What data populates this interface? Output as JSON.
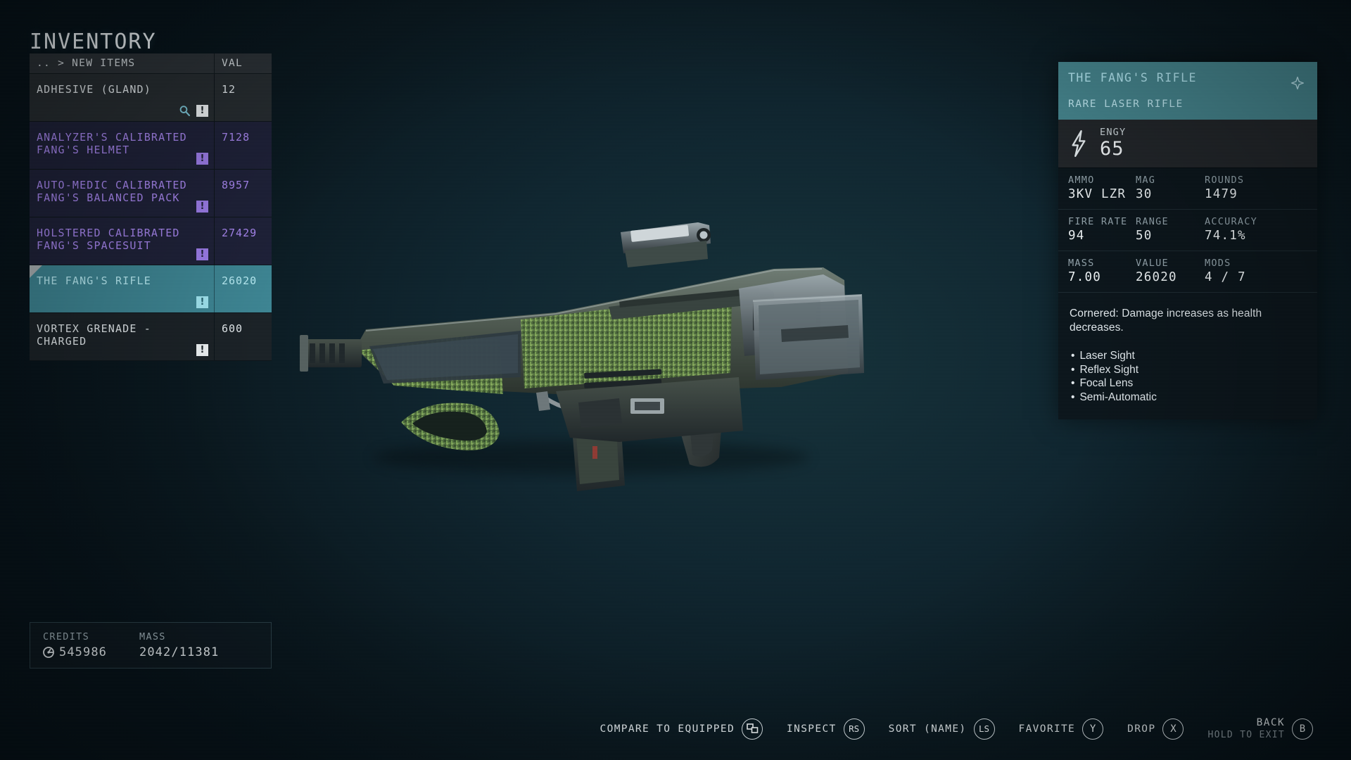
{
  "page_title": "INVENTORY",
  "list": {
    "header": {
      "name": ".. > NEW ITEMS",
      "value": "VAL"
    },
    "rows": [
      {
        "name": "ADHESIVE (GLAND)",
        "value": "12",
        "rarity": "common",
        "badges": [
          "magnifier-icon",
          "new-badge"
        ]
      },
      {
        "name": "ANALYZER'S CALIBRATED\nFANG'S HELMET",
        "value": "7128",
        "rarity": "epic",
        "badges": [
          "new-badge"
        ]
      },
      {
        "name": "AUTO-MEDIC CALIBRATED\nFANG'S BALANCED PACK",
        "value": "8957",
        "rarity": "epic",
        "badges": [
          "new-badge"
        ]
      },
      {
        "name": "HOLSTERED CALIBRATED\nFANG'S SPACESUIT",
        "value": "27429",
        "rarity": "epic",
        "badges": [
          "new-badge"
        ]
      },
      {
        "name": "THE FANG'S RIFLE",
        "value": "26020",
        "rarity": "selected",
        "badges": [
          "new-badge"
        ]
      },
      {
        "name": "VORTEX GRENADE -\nCHARGED",
        "value": "600",
        "rarity": "plain",
        "badges": [
          "new-badge"
        ]
      }
    ]
  },
  "credits": {
    "credits_label": "CREDITS",
    "credits_value": "545986",
    "mass_label": "MASS",
    "mass_value": "2042/11381"
  },
  "detail": {
    "title": "THE FANG'S RIFLE",
    "subtitle": "RARE LASER RIFLE",
    "favorite_icon": "four-point-star-icon",
    "damage": {
      "icon": "energy-bolt-icon",
      "label": "ENGY",
      "value": "65"
    },
    "stats": [
      [
        {
          "label": "AMMO",
          "value": "3KV LZR"
        },
        {
          "label": "MAG",
          "value": "30"
        },
        {
          "label": "ROUNDS",
          "value": "1479"
        }
      ],
      [
        {
          "label": "FIRE RATE",
          "value": "94"
        },
        {
          "label": "RANGE",
          "value": "50"
        },
        {
          "label": "ACCURACY",
          "value": "74.1%"
        }
      ],
      [
        {
          "label": "MASS",
          "value": "7.00"
        },
        {
          "label": "VALUE",
          "value": "26020"
        },
        {
          "label": "MODS",
          "value": "4 / 7"
        }
      ]
    ],
    "description": "Cornered: Damage increases as health decreases.",
    "mods": [
      "Laser Sight",
      "Reflex Sight",
      "Focal Lens",
      "Semi-Automatic"
    ]
  },
  "prompts": [
    {
      "label": "COMPARE TO EQUIPPED",
      "sub": "",
      "button": "⧉"
    },
    {
      "label": "INSPECT",
      "sub": "",
      "button": "RS"
    },
    {
      "label": "SORT (NAME)",
      "sub": "",
      "button": "LS"
    },
    {
      "label": "FAVORITE",
      "sub": "",
      "button": "Y"
    },
    {
      "label": "DROP",
      "sub": "",
      "button": "X"
    },
    {
      "label": "BACK",
      "sub": "HOLD TO EXIT",
      "button": "B"
    }
  ],
  "colors": {
    "accent_teal": "#46868f",
    "selected_text": "#b6eaf2",
    "epic_purple": "#a786f0",
    "background": "#0b1a20"
  }
}
